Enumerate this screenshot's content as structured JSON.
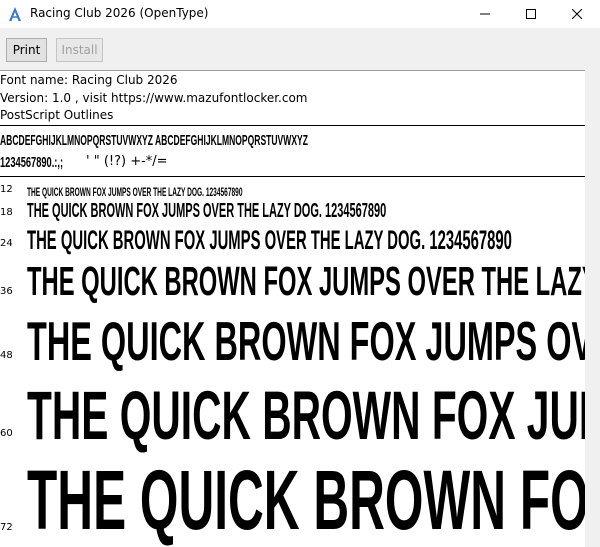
{
  "window": {
    "title": "Racing Club 2026 (OpenType)",
    "icon": "font-viewer-icon"
  },
  "toolbar": {
    "print_label": "Print",
    "install_label": "Install"
  },
  "info": {
    "font_name": "Font name: Racing Club 2026",
    "version": "Version: 1.0 , visit https://www.mazufontlocker.com",
    "outlines": "PostScript Outlines"
  },
  "charset": {
    "line1": "ABCDEFGHIJKLMNOPQRSTUVWXYZ ABCDEFGHIJKLMNOPQRSTUVWXYZ",
    "line2_digits": "1234567890.:,;",
    "line2_rest": " ' \" (!?) +-*/="
  },
  "samples": [
    {
      "size": "12",
      "text": "THE QUICK BROWN FOX JUMPS OVER THE LAZY DOG. 1234567890"
    },
    {
      "size": "18",
      "text": "THE QUICK BROWN FOX JUMPS OVER THE LAZY DOG. 1234567890"
    },
    {
      "size": "24",
      "text": "THE QUICK BROWN FOX JUMPS OVER THE LAZY DOG. 1234567890"
    },
    {
      "size": "36",
      "text": "THE QUICK BROWN FOX JUMPS OVER THE LAZY"
    },
    {
      "size": "48",
      "text": "THE QUICK BROWN FOX JUMPS OVE"
    },
    {
      "size": "60",
      "text": "THE QUICK BROWN FOX JUM"
    },
    {
      "size": "72",
      "text": "THE QUICK BROWN FOX"
    }
  ]
}
